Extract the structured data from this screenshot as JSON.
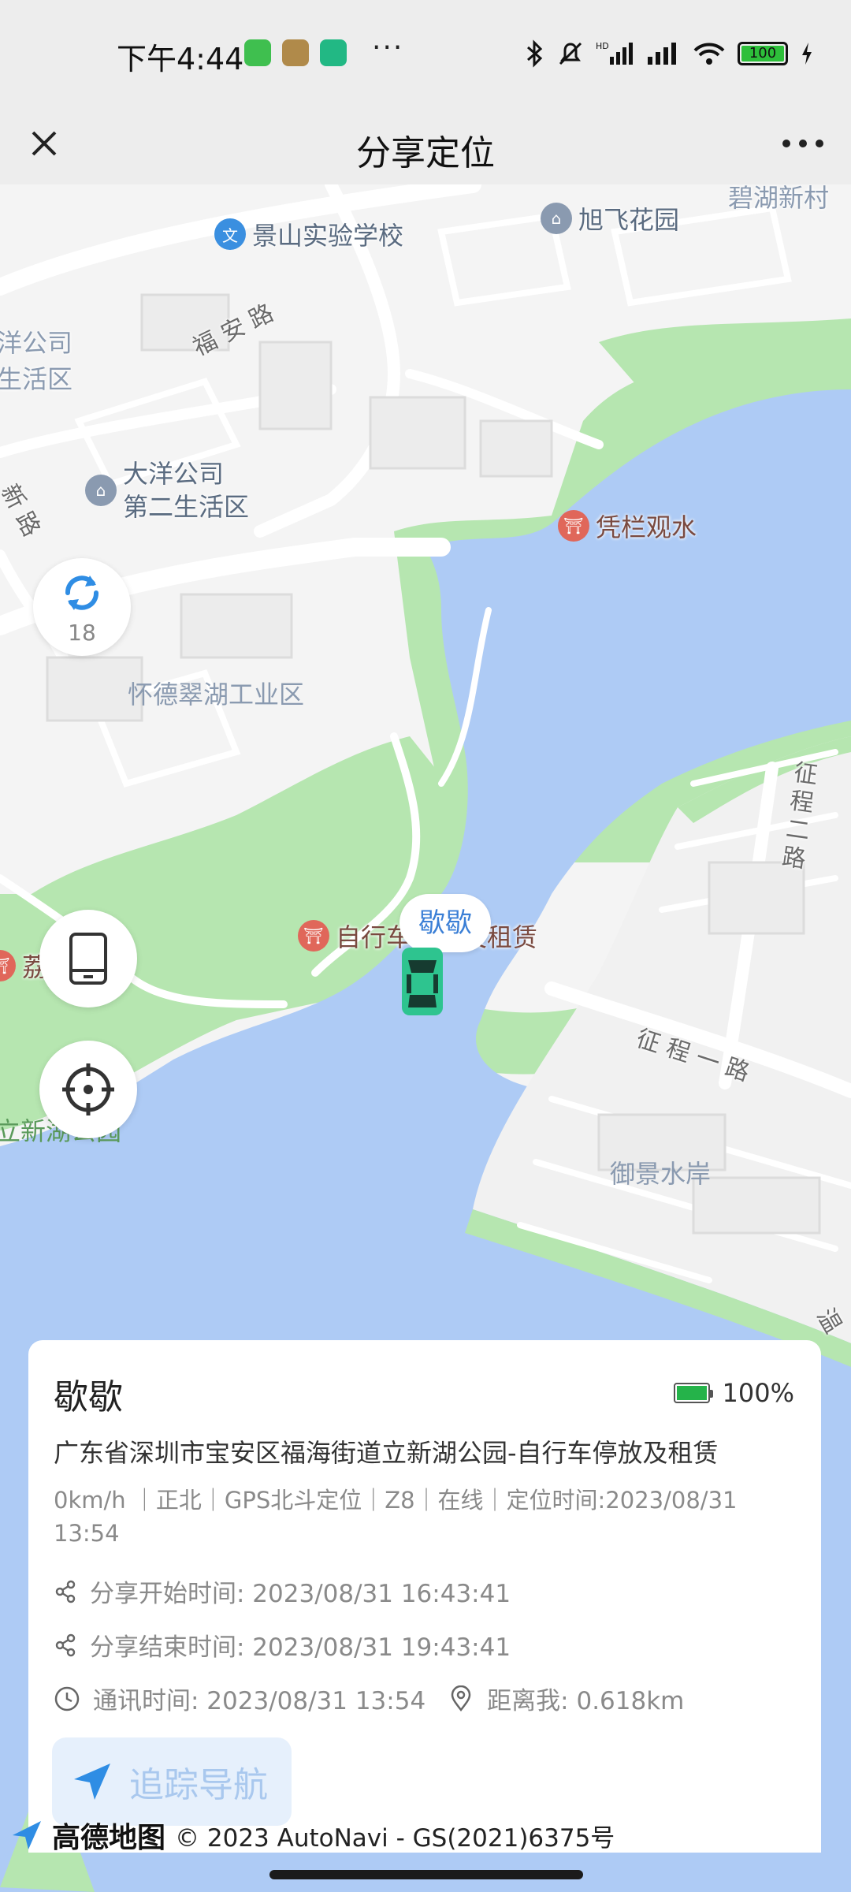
{
  "status_bar": {
    "time": "下午4:44",
    "dots": "···",
    "battery": "100"
  },
  "nav": {
    "title": "分享定位"
  },
  "map": {
    "pois": {
      "school": "景山实验学校",
      "xufei": "旭飞花园",
      "bihu": "碧湖新村",
      "daiyang": "大洋公司\n第二生活区",
      "pinglan": "凭栏观水",
      "bike": "自行车停放及租赁",
      "left_area_1": "洋公司",
      "left_area_2": "生活区"
    },
    "roads": {
      "fuan": "福 安 路",
      "xinroad": "新 路",
      "zhengcheng2": "征\n程\n二\n路",
      "zhengcheng1": "征 程 一 路",
      "wen": "温"
    },
    "areas": {
      "huaide": "怀德翠湖工业区",
      "yujing": "御景水岸",
      "lixinhu": "立新湖公园",
      "jiao": "荔"
    },
    "refresh_count": "18",
    "car_label": "歇歇"
  },
  "card": {
    "name": "歇歇",
    "battery_pct": "100%",
    "address": "广东省深圳市宝安区福海街道立新湖公园-自行车停放及租赁",
    "meta": "0km/h ｜正北｜GPS北斗定位｜Z8｜在线｜定位时间:2023/08/31 13:54",
    "share_start": "分享开始时间: 2023/08/31 16:43:41",
    "share_end": "分享结束时间: 2023/08/31 19:43:41",
    "comm_time": "通讯时间: 2023/08/31 13:54",
    "distance": "距离我: 0.618km",
    "nav_button": "追踪导航"
  },
  "attribution": {
    "brand": "高德地图",
    "copyright": "© 2023 AutoNavi - GS(2021)6375号"
  },
  "colors": {
    "water": "#aecbf5",
    "green": "#b6e6b0",
    "accent": "#2f8de4",
    "car": "#2ec48f"
  }
}
